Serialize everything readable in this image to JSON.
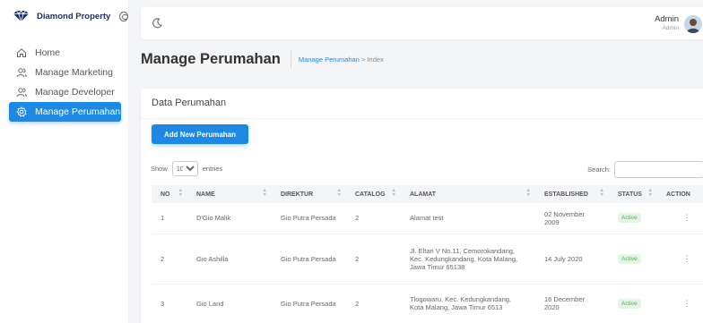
{
  "brand": {
    "name": "Diamond Property"
  },
  "colors": {
    "accent": "#1e88e5",
    "brand": "#1e2d5c",
    "status_active_bg": "#e4f5e6",
    "status_active_fg": "#4caf50"
  },
  "sidebar": {
    "items": [
      {
        "label": "Home",
        "icon": "home-icon"
      },
      {
        "label": "Manage Marketing",
        "icon": "users-icon"
      },
      {
        "label": "Manage Developer",
        "icon": "users-icon"
      },
      {
        "label": "Manage Perumahan",
        "icon": "gear-icon",
        "active": true
      }
    ]
  },
  "topbar": {
    "user_name": "Admin",
    "user_role": "Admin",
    "theme_icon": "moon-icon"
  },
  "header": {
    "title": "Manage Perumahan",
    "breadcrumb_link": "Manage Perumahan",
    "breadcrumb_sep": ">",
    "breadcrumb_current": "Index"
  },
  "card": {
    "title": "Data Perumahan",
    "add_button": "Add New Perumahan",
    "show_label": "Show",
    "entries_value": "10",
    "entries_label": "entries",
    "search_label": "Search:"
  },
  "table": {
    "headers": [
      "NO",
      "NAME",
      "DIREKTUR",
      "CATALOG",
      "ALAMAT",
      "ESTABLISHED",
      "STATUS",
      "ACTION"
    ],
    "rows": [
      {
        "no": "1",
        "name": "D'Gio Malik",
        "direktur": "Gio Putra Persada",
        "catalog": "2",
        "alamat": "Alamat test",
        "established": "02 November 2009",
        "status": "Active",
        "action": "⋮"
      },
      {
        "no": "2",
        "name": "Gio Ashilla",
        "direktur": "Gio Putra Persada",
        "catalog": "2",
        "alamat": "Jl. Eltari V No.11, Cemorokandang, Kec. Kedungkandang, Kota Malang, Jawa Timur 65138",
        "established": "14 July 2020",
        "status": "Active",
        "action": "⋮"
      },
      {
        "no": "3",
        "name": "Gio Land",
        "direktur": "Gio Putra Persada",
        "catalog": "2",
        "alamat": "Tlogowaru, Kec. Kedungkandang, Kota Malang, Jawa Timur 6513",
        "established": "16 December 2020",
        "status": "Active",
        "action": "⋮"
      }
    ]
  }
}
